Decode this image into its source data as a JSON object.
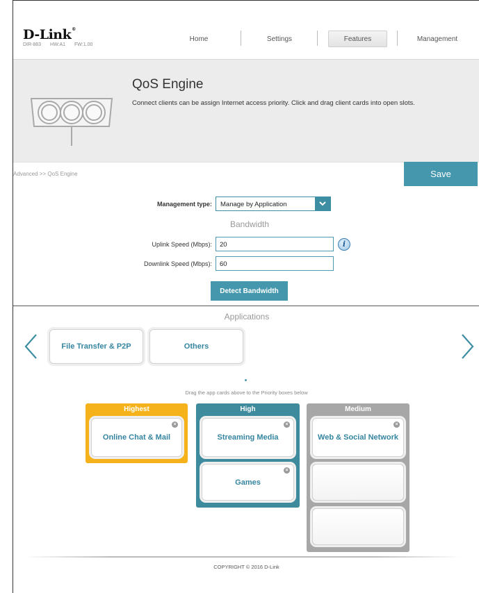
{
  "header": {
    "logo": "D-Link",
    "logo_mark": "®",
    "model": "DIR-883",
    "hw": "HW:A1",
    "fw": "FW:1.00",
    "nav": {
      "home": "Home",
      "settings": "Settings",
      "features": "Features",
      "management": "Management"
    },
    "active_nav": "Features"
  },
  "banner": {
    "title": "QoS Engine",
    "description": "Connect clients can be assign Internet access priority. Click and drag client cards into open slots.",
    "icon": "qos-engine-icon"
  },
  "breadcrumb": "Advanced >> QoS Engine",
  "save_label": "Save",
  "form": {
    "management_type_label": "Management type:",
    "management_type_value": "Manage by Application",
    "bandwidth_heading": "Bandwidth",
    "uplink_label": "Uplink Speed (Mbps):",
    "uplink_value": "20",
    "downlink_label": "Downlink Speed (Mbps):",
    "downlink_value": "60",
    "detect_label": "Detect Bandwidth"
  },
  "applications": {
    "heading": "Applications",
    "cards": [
      "File Transfer & P2P",
      "Others"
    ],
    "hint": "Drag the app cards above to the Priority boxes below"
  },
  "priority": {
    "highest": {
      "title": "Highest",
      "color": "#f5b21a",
      "cards": [
        "Online Chat & Mail"
      ]
    },
    "high": {
      "title": "High",
      "color": "#3e8b9d",
      "cards": [
        "Streaming Media",
        "Games"
      ]
    },
    "medium": {
      "title": "Medium",
      "color": "#a7a7a7",
      "cards": [
        "Web & Social Network"
      ]
    }
  },
  "colors": {
    "accent": "#4497ad",
    "link": "#3585a0"
  },
  "footer": {
    "copyright": "COPYRIGHT © 2016 D-Link"
  }
}
